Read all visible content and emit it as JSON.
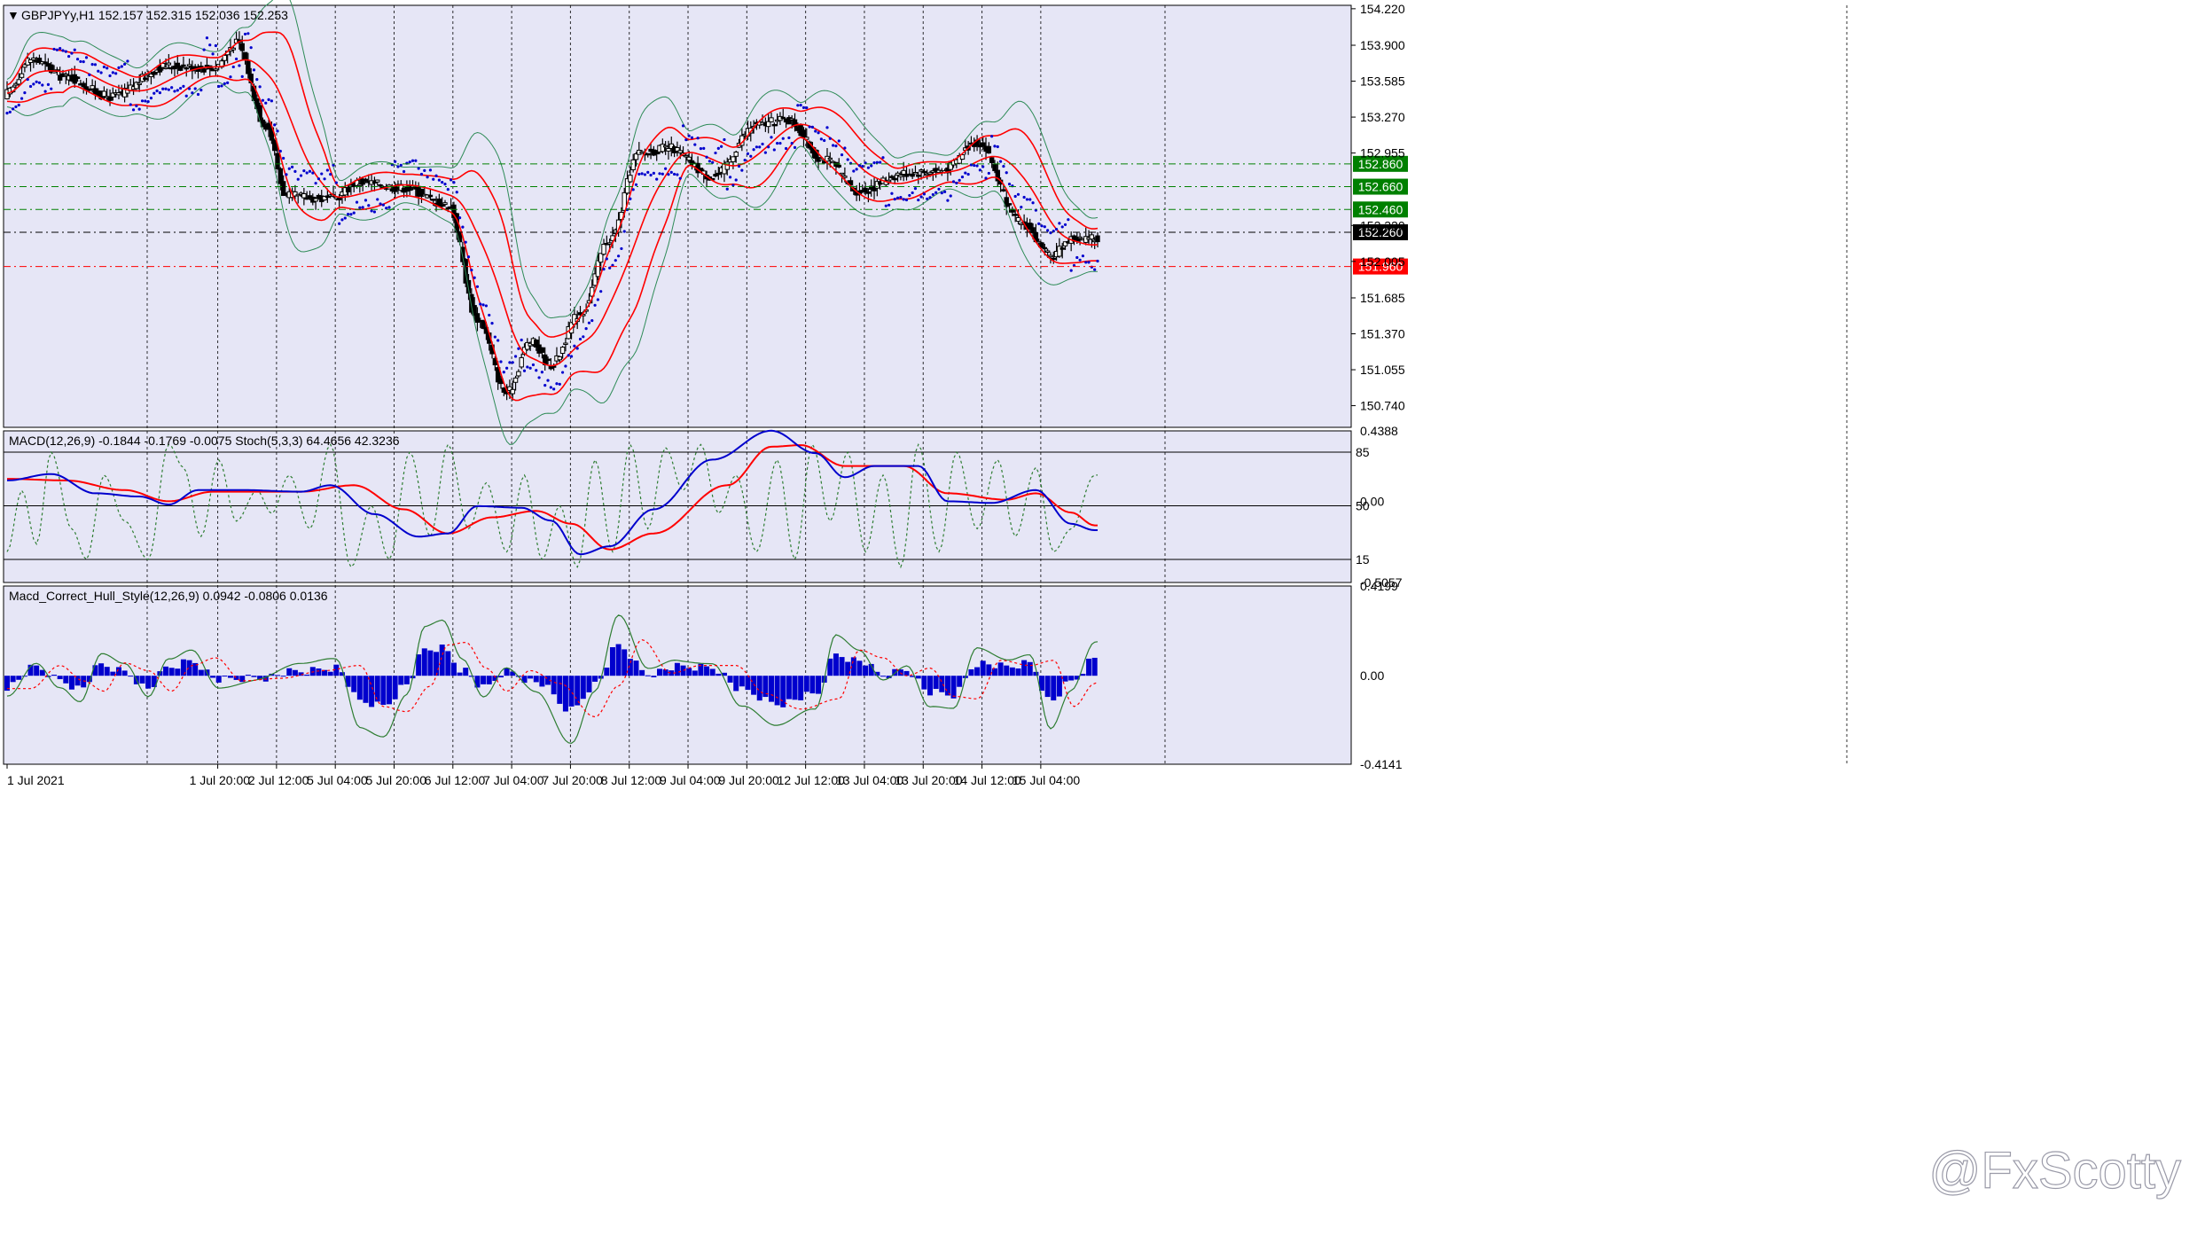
{
  "chart_data": {
    "type": "candlestick",
    "symbol_header": "GBPJPYy,H1  152.157 152.315 152.036 152.253",
    "panes": {
      "price": {
        "ylim": [
          150.55,
          154.25
        ],
        "y_ticks": [
          "154.220",
          "153.900",
          "153.585",
          "153.270",
          "152.955",
          "152.320",
          "152.005",
          "151.685",
          "151.370",
          "151.055",
          "150.740"
        ],
        "levels": [
          {
            "value": 152.86,
            "label": "152.860",
            "color": "#008000",
            "style": "dash-dot"
          },
          {
            "value": 152.66,
            "label": "152.660",
            "color": "#008000",
            "style": "dash-dot"
          },
          {
            "value": 152.46,
            "label": "152.460",
            "color": "#008000",
            "style": "dash-dot"
          },
          {
            "value": 152.26,
            "label": "152.260",
            "color": "#000000",
            "style": "dash-dot"
          },
          {
            "value": 151.96,
            "label": "151.960",
            "color": "#ff0000",
            "style": "dash-dot"
          }
        ],
        "anchors": [
          [
            0,
            153.48
          ],
          [
            8,
            153.78
          ],
          [
            20,
            153.62
          ],
          [
            35,
            153.45
          ],
          [
            55,
            153.72
          ],
          [
            70,
            153.7
          ],
          [
            78,
            153.92
          ],
          [
            88,
            153.2
          ],
          [
            95,
            152.58
          ],
          [
            110,
            152.55
          ],
          [
            120,
            152.7
          ],
          [
            135,
            152.65
          ],
          [
            150,
            152.5
          ],
          [
            160,
            151.5
          ],
          [
            170,
            150.85
          ],
          [
            178,
            151.3
          ],
          [
            185,
            151.1
          ],
          [
            195,
            151.55
          ],
          [
            205,
            152.2
          ],
          [
            215,
            152.95
          ],
          [
            225,
            153.0
          ],
          [
            240,
            152.75
          ],
          [
            255,
            153.2
          ],
          [
            265,
            153.25
          ],
          [
            278,
            152.9
          ],
          [
            290,
            152.62
          ],
          [
            305,
            152.78
          ],
          [
            318,
            152.8
          ],
          [
            330,
            153.05
          ],
          [
            345,
            152.35
          ],
          [
            355,
            152.05
          ],
          [
            362,
            152.2
          ]
        ],
        "bands": {
          "upper_color": "#2e8b57",
          "mid_color": "#ff0000"
        },
        "psar_color": "#0000cd"
      },
      "macd_stoch": {
        "label": "MACD(12,26,9) -0.1844 -0.1769 -0.0075  Stoch(5,3,3) 64.4656 42.3236",
        "ylim": [
          -0.5057,
          0.4388
        ],
        "y_ticks": [
          "0.4388",
          "0.00",
          "-0.5057"
        ],
        "stoch_levels": [
          "85",
          "50",
          "15"
        ],
        "macd_anchors": [
          [
            0,
            0.13
          ],
          [
            15,
            0.17
          ],
          [
            30,
            0.05
          ],
          [
            45,
            0.03
          ],
          [
            55,
            -0.02
          ],
          [
            65,
            0.07
          ],
          [
            80,
            0.07
          ],
          [
            100,
            0.06
          ],
          [
            110,
            0.1
          ],
          [
            125,
            -0.08
          ],
          [
            140,
            -0.22
          ],
          [
            150,
            -0.2
          ],
          [
            160,
            -0.03
          ],
          [
            175,
            -0.04
          ],
          [
            185,
            -0.12
          ],
          [
            195,
            -0.33
          ],
          [
            205,
            -0.28
          ],
          [
            220,
            -0.05
          ],
          [
            240,
            0.26
          ],
          [
            260,
            0.44
          ],
          [
            275,
            0.3
          ],
          [
            285,
            0.15
          ],
          [
            295,
            0.22
          ],
          [
            310,
            0.22
          ],
          [
            320,
            0.0
          ],
          [
            335,
            -0.01
          ],
          [
            350,
            0.07
          ],
          [
            362,
            -0.14
          ],
          [
            370,
            -0.18
          ]
        ],
        "signal_anchors": [
          [
            0,
            0.14
          ],
          [
            20,
            0.13
          ],
          [
            40,
            0.07
          ],
          [
            55,
            0.0
          ],
          [
            70,
            0.06
          ],
          [
            100,
            0.06
          ],
          [
            118,
            0.1
          ],
          [
            135,
            -0.05
          ],
          [
            150,
            -0.2
          ],
          [
            165,
            -0.1
          ],
          [
            180,
            -0.06
          ],
          [
            192,
            -0.14
          ],
          [
            205,
            -0.3
          ],
          [
            220,
            -0.2
          ],
          [
            245,
            0.1
          ],
          [
            260,
            0.34
          ],
          [
            270,
            0.35
          ],
          [
            285,
            0.22
          ],
          [
            305,
            0.22
          ],
          [
            320,
            0.05
          ],
          [
            340,
            0.01
          ],
          [
            350,
            0.05
          ],
          [
            362,
            -0.07
          ],
          [
            370,
            -0.15
          ]
        ],
        "stoch_anchors": [
          [
            0,
            20
          ],
          [
            5,
            60
          ],
          [
            10,
            25
          ],
          [
            15,
            85
          ],
          [
            22,
            35
          ],
          [
            27,
            15
          ],
          [
            33,
            70
          ],
          [
            40,
            40
          ],
          [
            48,
            15
          ],
          [
            55,
            90
          ],
          [
            60,
            75
          ],
          [
            66,
            30
          ],
          [
            72,
            80
          ],
          [
            78,
            40
          ],
          [
            85,
            60
          ],
          [
            90,
            45
          ],
          [
            96,
            70
          ],
          [
            103,
            35
          ],
          [
            110,
            90
          ],
          [
            117,
            10
          ],
          [
            124,
            50
          ],
          [
            130,
            15
          ],
          [
            137,
            85
          ],
          [
            144,
            30
          ],
          [
            150,
            90
          ],
          [
            157,
            35
          ],
          [
            163,
            65
          ],
          [
            170,
            20
          ],
          [
            176,
            70
          ],
          [
            182,
            15
          ],
          [
            188,
            50
          ],
          [
            194,
            10
          ],
          [
            200,
            80
          ],
          [
            206,
            20
          ],
          [
            212,
            90
          ],
          [
            218,
            35
          ],
          [
            224,
            88
          ],
          [
            230,
            60
          ],
          [
            236,
            90
          ],
          [
            242,
            45
          ],
          [
            248,
            70
          ],
          [
            255,
            20
          ],
          [
            262,
            80
          ],
          [
            268,
            15
          ],
          [
            274,
            90
          ],
          [
            280,
            40
          ],
          [
            286,
            85
          ],
          [
            292,
            20
          ],
          [
            298,
            70
          ],
          [
            304,
            10
          ],
          [
            310,
            90
          ],
          [
            317,
            20
          ],
          [
            323,
            85
          ],
          [
            330,
            35
          ],
          [
            337,
            80
          ],
          [
            343,
            30
          ],
          [
            350,
            75
          ],
          [
            356,
            20
          ],
          [
            362,
            35
          ],
          [
            370,
            70
          ]
        ],
        "macd_color": "#0000cd",
        "signal_color": "#ff0000",
        "stoch_color": "#2e7d32"
      },
      "hull": {
        "label": "Macd_Correct_Hull_Style(12,26,9) 0.0942 -0.0806 0.0136",
        "ylim": [
          -0.4141,
          0.4199
        ],
        "y_ticks": [
          "0.4199",
          "0.00",
          "-0.4141"
        ],
        "hist_anchors": [
          [
            0,
            -0.05
          ],
          [
            10,
            0.04
          ],
          [
            18,
            -0.02
          ],
          [
            25,
            -0.06
          ],
          [
            32,
            0.05
          ],
          [
            40,
            0.02
          ],
          [
            48,
            -0.06
          ],
          [
            55,
            0.04
          ],
          [
            63,
            0.07
          ],
          [
            72,
            -0.02
          ],
          [
            85,
            -0.01
          ],
          [
            100,
            0.02
          ],
          [
            112,
            0.04
          ],
          [
            120,
            -0.12
          ],
          [
            128,
            -0.14
          ],
          [
            136,
            -0.04
          ],
          [
            142,
            0.12
          ],
          [
            148,
            0.13
          ],
          [
            155,
            0.03
          ],
          [
            162,
            -0.06
          ],
          [
            170,
            0.02
          ],
          [
            180,
            -0.03
          ],
          [
            192,
            -0.16
          ],
          [
            200,
            -0.04
          ],
          [
            208,
            0.14
          ],
          [
            218,
            0.01
          ],
          [
            228,
            0.04
          ],
          [
            240,
            0.04
          ],
          [
            250,
            -0.07
          ],
          [
            262,
            -0.13
          ],
          [
            275,
            -0.09
          ],
          [
            282,
            0.1
          ],
          [
            290,
            0.07
          ],
          [
            298,
            0.0
          ],
          [
            306,
            0.03
          ],
          [
            314,
            -0.08
          ],
          [
            322,
            -0.09
          ],
          [
            330,
            0.06
          ],
          [
            340,
            0.04
          ],
          [
            348,
            0.06
          ],
          [
            355,
            -0.12
          ],
          [
            362,
            -0.03
          ],
          [
            370,
            0.08
          ]
        ],
        "hist_color": "#0000cd",
        "line1_color": "#2e7d32",
        "line2_color": "#ff0000"
      }
    },
    "x_labels": [
      {
        "bar": 0,
        "label": "1 Jul 2021"
      },
      {
        "bar": 24,
        "label": "1 Jul 20:00"
      },
      {
        "bar": 44,
        "label": "2 Jul 12:00"
      },
      {
        "bar": 64,
        "label": "5 Jul 04:00"
      },
      {
        "bar": 84,
        "label": "5 Jul 20:00"
      },
      {
        "bar": 104,
        "label": "6 Jul 12:00"
      },
      {
        "bar": 124,
        "label": "7 Jul 04:00"
      },
      {
        "bar": 144,
        "label": "7 Jul 20:00"
      },
      {
        "bar": 164,
        "label": "8 Jul 12:00"
      },
      {
        "bar": 184,
        "label": "9 Jul 04:00"
      },
      {
        "bar": 204,
        "label": "9 Jul 20:00"
      },
      {
        "bar": 224,
        "label": "12 Jul 12:00"
      },
      {
        "bar": 244,
        "label": "13 Jul 04:00"
      },
      {
        "bar": 264,
        "label": "13 Jul 20:00"
      },
      {
        "bar": 284,
        "label": "14 Jul 12:00"
      },
      {
        "bar": 304,
        "label": "15 Jul 04:00"
      }
    ],
    "watermark": "@FxScotty",
    "colors": {
      "background": "#e6e6f6",
      "grid": "#000000",
      "candle_up": "#ffffff",
      "candle_down": "#000000"
    }
  }
}
